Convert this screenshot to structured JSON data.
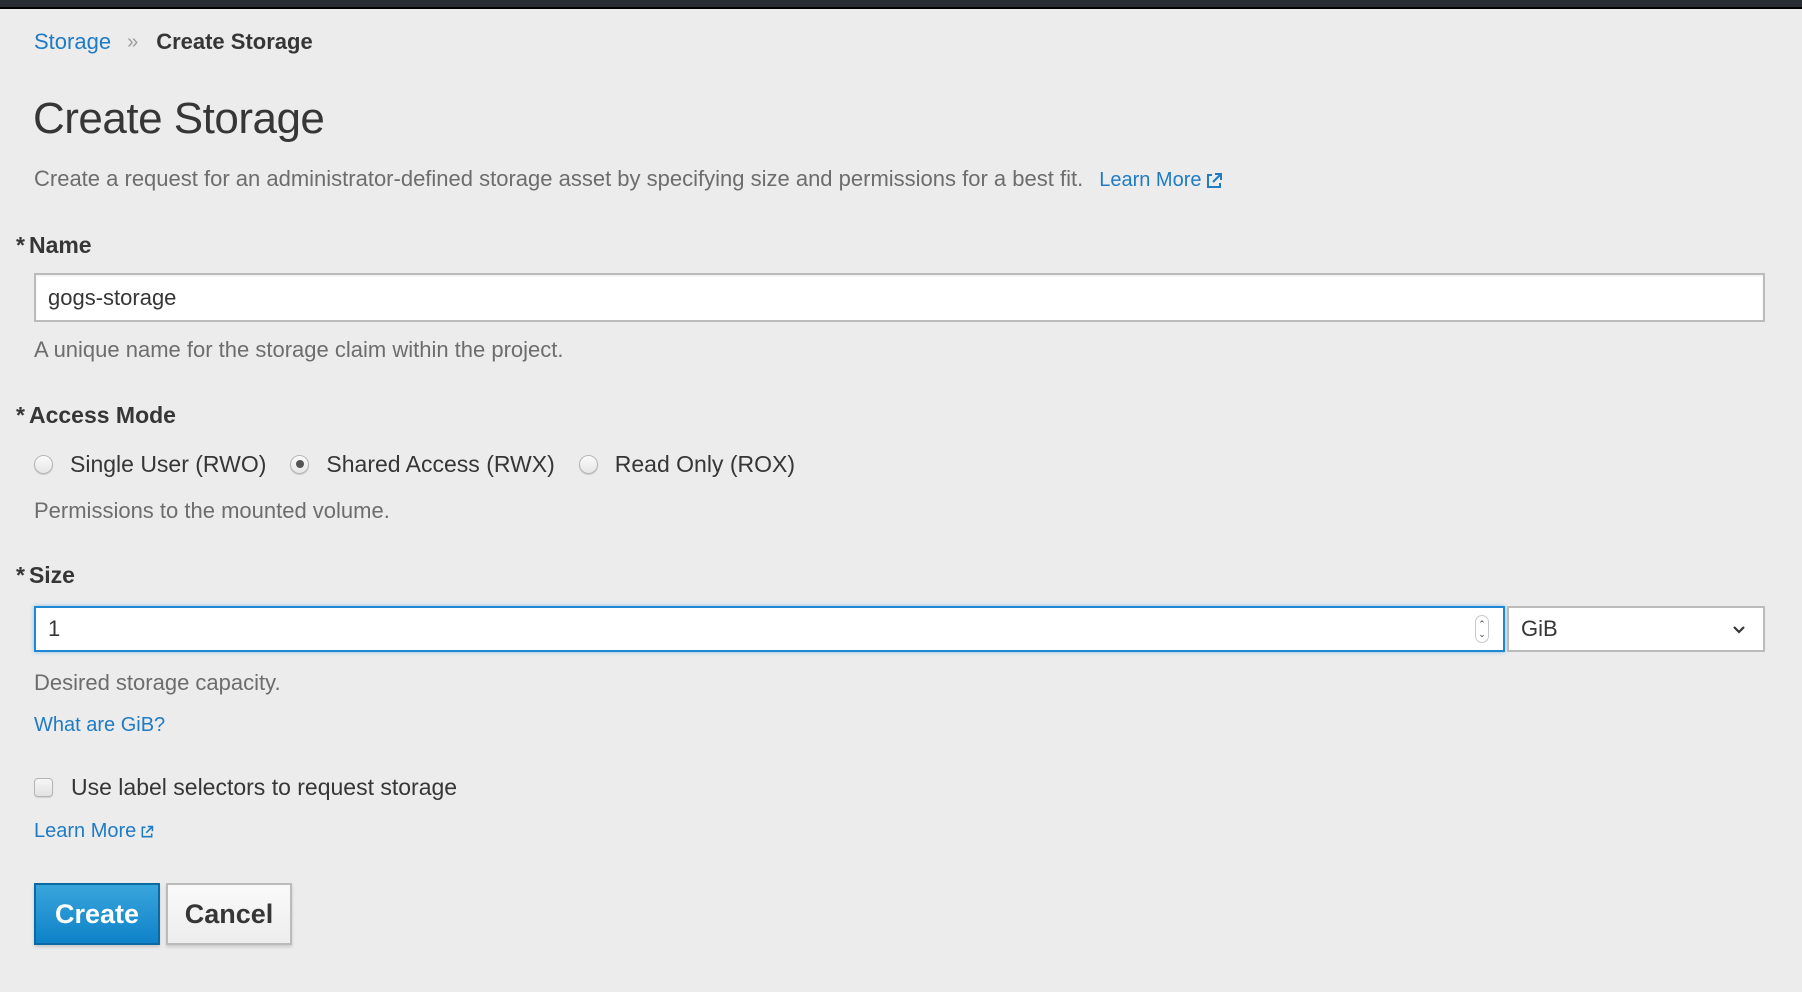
{
  "breadcrumb": {
    "parent": "Storage",
    "separator": "»",
    "current": "Create Storage"
  },
  "page": {
    "title": "Create Storage",
    "description": "Create a request for an administrator-defined storage asset by specifying size and permissions for a best fit.",
    "learn_more": "Learn More"
  },
  "name_field": {
    "required_marker": "*",
    "label": "Name",
    "value": "gogs-storage",
    "help": "A unique name for the storage claim within the project."
  },
  "access_mode": {
    "required_marker": "*",
    "label": "Access Mode",
    "options": [
      {
        "label": "Single User (RWO)",
        "selected": false
      },
      {
        "label": "Shared Access (RWX)",
        "selected": true
      },
      {
        "label": "Read Only (ROX)",
        "selected": false
      }
    ],
    "help": "Permissions to the mounted volume."
  },
  "size_field": {
    "required_marker": "*",
    "label": "Size",
    "value": "1",
    "unit": "GiB",
    "help": "Desired storage capacity.",
    "units_link": "What are GiB?"
  },
  "label_selectors": {
    "label": "Use label selectors to request storage",
    "checked": false,
    "learn_more": "Learn More"
  },
  "actions": {
    "create": "Create",
    "cancel": "Cancel"
  },
  "colors": {
    "link": "#1f7bc4",
    "primary": "#0e82c8",
    "background": "#ececec"
  }
}
